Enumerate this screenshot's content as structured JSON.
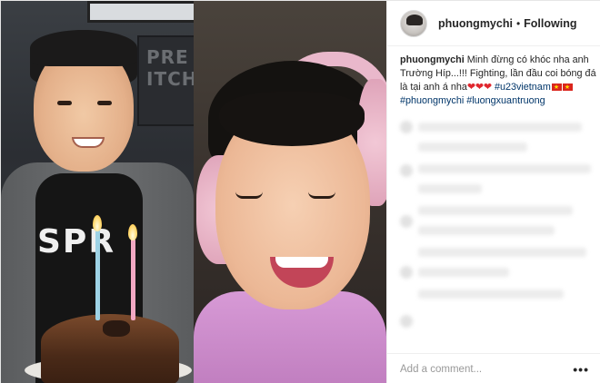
{
  "post": {
    "media": {
      "left_photo": {
        "shop_sign": "PRE\nITCH",
        "shirt_text": "SPR"
      },
      "right_photo": {}
    },
    "header": {
      "username": "phuongmychi",
      "separator": "•",
      "follow_state": "Following"
    },
    "caption": {
      "username": "phuongmychi",
      "text": " Minh đừng có khóc nha anh Trường Híp...!!! Fighting, lần đầu coi bóng đá là tại anh á nha",
      "hearts": "❤❤❤",
      "hashtag_1": "#u23vietnam",
      "hashtag_2": "#phuongmychi",
      "hashtag_3": "#luongxuantruong"
    },
    "add_comment": {
      "placeholder": "Add a comment...",
      "more_label": "•••"
    },
    "colors": {
      "text": "#262626",
      "hashtag": "#003569",
      "border": "#efefef",
      "heart": "#e0282f"
    },
    "icons": [
      "avatar",
      "flag-vietnam-icon",
      "more-options-icon"
    ]
  }
}
